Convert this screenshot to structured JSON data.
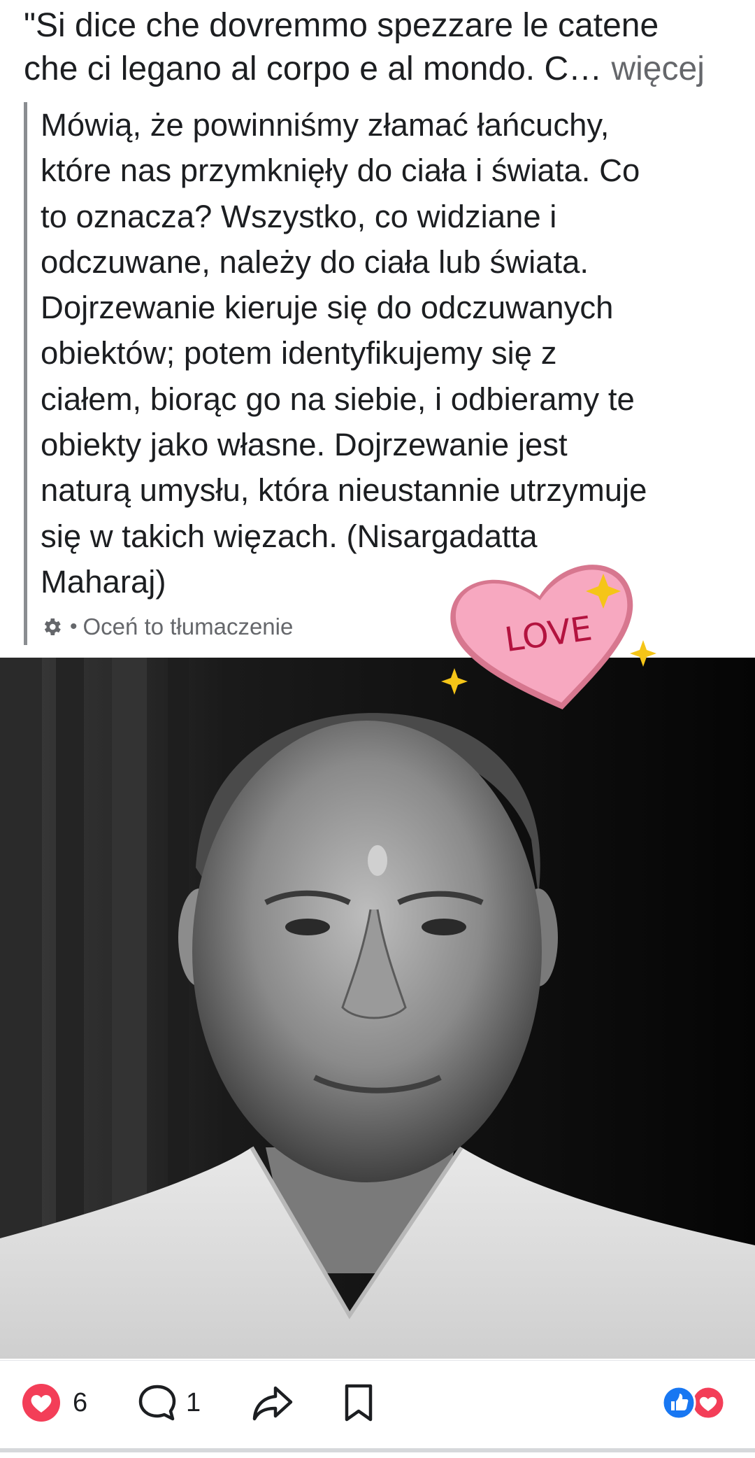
{
  "post": {
    "original_text": "\"Si dice che dovremmo spezzare le catene\nche ci legano al corpo e al mondo. C… ",
    "more_label": "więcej",
    "translation": "Mówią, że powinniśmy złamać łańcuchy,\nktóre nas przymknięły do ciała i świata. Co\nto oznacza? Wszystko, co widziane i\nodczuwane, należy do ciała lub świata.\nDojrzewanie kieruje się do odczuwanych\nobiektów; potem identyfikujemy się z\nciałem, biorąc go na siebie, i odbieramy te\nobiekty jako własne. Dojrzewanie jest\nnaturą umysłu, która nieustannie utrzymuje\nsię w takich więzach. (Nisargadatta\nMaharaj)",
    "rate_translation_label": "Oceń to tłumaczenie",
    "rate_icon": "gear-icon"
  },
  "sticker": {
    "text": "LOVE",
    "heart_color": "#f7a8c0",
    "text_color": "#b3133f",
    "sparkle_color": "#f5c518"
  },
  "actions": {
    "reaction_count": "6",
    "comment_count": "1",
    "reaction_icon": "heart-icon",
    "comment_icon": "comment-icon",
    "share_icon": "share-icon",
    "save_icon": "bookmark-icon",
    "summary_icons": [
      "like-icon",
      "love-icon"
    ]
  },
  "colors": {
    "like_blue": "#1877f2",
    "love_red": "#f33e58",
    "secondary_text": "#65676b"
  }
}
